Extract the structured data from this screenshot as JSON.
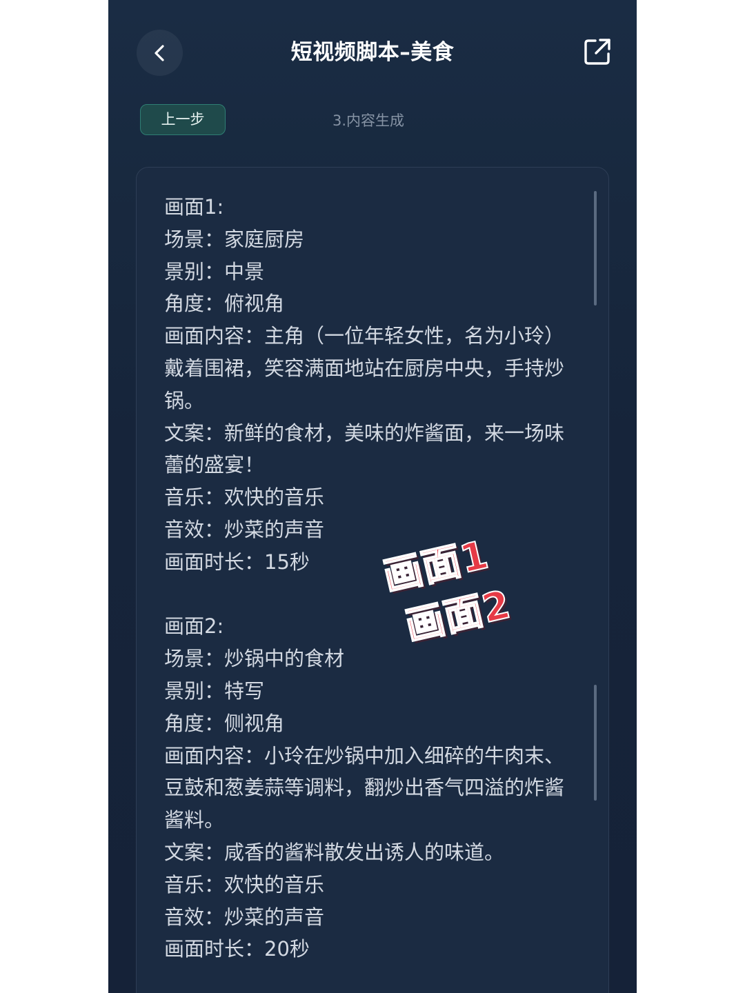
{
  "header": {
    "title": "短视频脚本–美食",
    "back_icon": "chevron-left-icon",
    "share_icon": "external-link-icon"
  },
  "toolbar": {
    "prev_label": "上一步",
    "step_label": "3.内容生成"
  },
  "scenes": [
    {
      "heading": "画面1:",
      "lines": [
        "场景：家庭厨房",
        "景别：中景",
        "角度：俯视角",
        "画面内容：主角（一位年轻女性，名为小玲）戴着围裙，笑容满面地站在厨房中央，手持炒锅。",
        "文案：新鲜的食材，美味的炸酱面，来一场味蕾的盛宴！",
        "音乐：欢快的音乐",
        "音效：炒菜的声音",
        "画面时长：15秒"
      ]
    },
    {
      "heading": "画面2:",
      "lines": [
        "场景：炒锅中的食材",
        "景别：特写",
        "角度：侧视角",
        "画面内容：小玲在炒锅中加入细碎的牛肉末、豆鼓和葱姜蒜等调料，翻炒出香气四溢的炸酱酱料。",
        "文案：咸香的酱料散发出诱人的味道。",
        "音乐：欢快的音乐",
        "音效：炒菜的声音",
        "画面时长：20秒"
      ]
    }
  ],
  "overlay": {
    "label1": "画面1",
    "label2": "画面2",
    "color": "#e63a46"
  },
  "colors": {
    "background": "#18293f",
    "card": "#1b2b42",
    "accent": "#2f7f74",
    "text": "#d3d9e2"
  }
}
